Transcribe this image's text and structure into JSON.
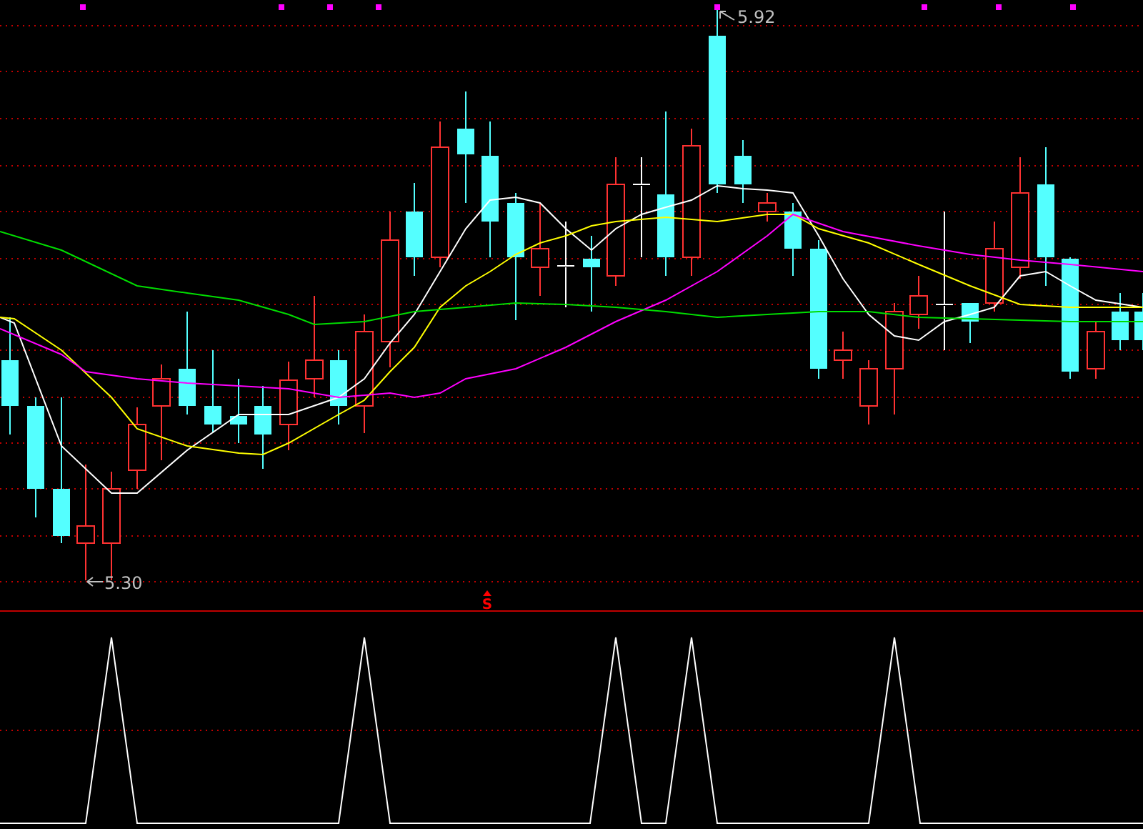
{
  "price_chart": {
    "high_label": "5.92",
    "low_label": "5.30",
    "signal": "S"
  }
}
